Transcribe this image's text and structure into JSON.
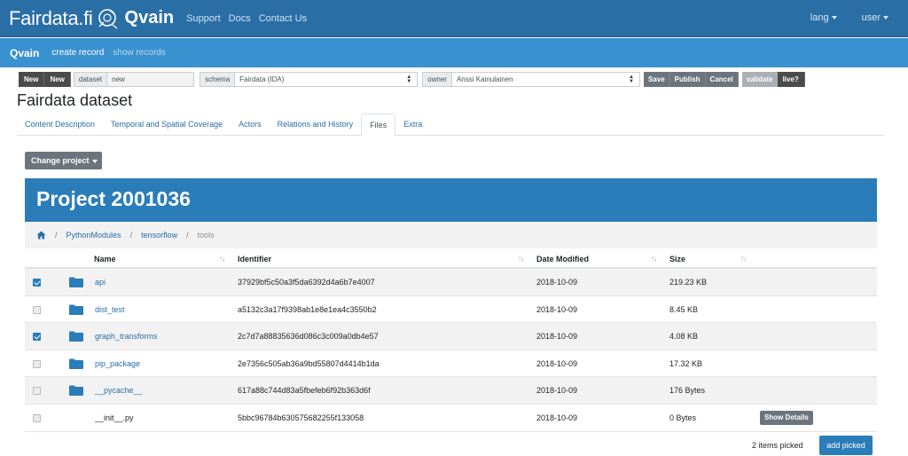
{
  "topbar": {
    "brand_name": "Fairdata.fi",
    "app_name": "Qvain",
    "nav": [
      "Support",
      "Docs",
      "Contact Us"
    ],
    "lang_label": "lang",
    "user_label": "user",
    "color": "#2a6ea6"
  },
  "subbar": {
    "app_name": "Qvain",
    "create_record": "create record",
    "show_records": "show records",
    "color": "#3a91d0"
  },
  "toolbar": {
    "new_btn_1": "New",
    "new_btn_2": "New",
    "dataset_label": "dataset",
    "dataset_value": "new",
    "schema_label": "schema",
    "schema_value": "Fairdata (IDA)",
    "owner_label": "owner",
    "owner_value": "Anssi Kainulainen",
    "save": "Save",
    "publish": "Publish",
    "cancel": "Cancel",
    "validate": "validate",
    "live": "live?"
  },
  "page_title": "Fairdata dataset",
  "tabs": [
    {
      "label": "Content Description",
      "active": false
    },
    {
      "label": "Temporal and Spatial Coverage",
      "active": false
    },
    {
      "label": "Actors",
      "active": false
    },
    {
      "label": "Relations and History",
      "active": false
    },
    {
      "label": "Files",
      "active": true
    },
    {
      "label": "Extra",
      "active": false
    }
  ],
  "files": {
    "change_project": "Change project",
    "project_title": "Project 2001036",
    "breadcrumb": [
      "PythonModules",
      "tensorflow",
      "tools"
    ],
    "columns": {
      "name": "Name",
      "identifier": "Identifier",
      "date": "Date Modified",
      "size": "Size"
    },
    "rows": [
      {
        "checked": true,
        "is_folder": true,
        "name": "api",
        "identifier": "37929bf5c50a3f5da6392d4a6b7e4007",
        "date": "2018-10-09",
        "size": "219.23 KB"
      },
      {
        "checked": false,
        "is_folder": true,
        "name": "dist_test",
        "identifier": "a5132c3a17f9398ab1e8e1ea4c3550b2",
        "date": "2018-10-09",
        "size": "8.45 KB"
      },
      {
        "checked": true,
        "is_folder": true,
        "name": "graph_transforms",
        "identifier": "2c7d7a88835636d086c3c009a0db4e57",
        "date": "2018-10-09",
        "size": "4.08 KB"
      },
      {
        "checked": false,
        "is_folder": true,
        "name": "pip_package",
        "identifier": "2e7356c505ab36a9bd55807d4414b1da",
        "date": "2018-10-09",
        "size": "17.32 KB"
      },
      {
        "checked": false,
        "is_folder": true,
        "name": "__pycache__",
        "identifier": "617a88c744d83a5fbefeb6f92b363d6f",
        "date": "2018-10-09",
        "size": "176 Bytes"
      },
      {
        "checked": false,
        "is_folder": false,
        "name": "__init__.py",
        "identifier": "5bbc96784b630575682255f133058",
        "date": "2018-10-09",
        "size": "0 Bytes"
      }
    ],
    "show_details": "Show Details",
    "picked_count": "2 items picked",
    "add_picked": "add picked",
    "accent": "#2a7db8"
  }
}
